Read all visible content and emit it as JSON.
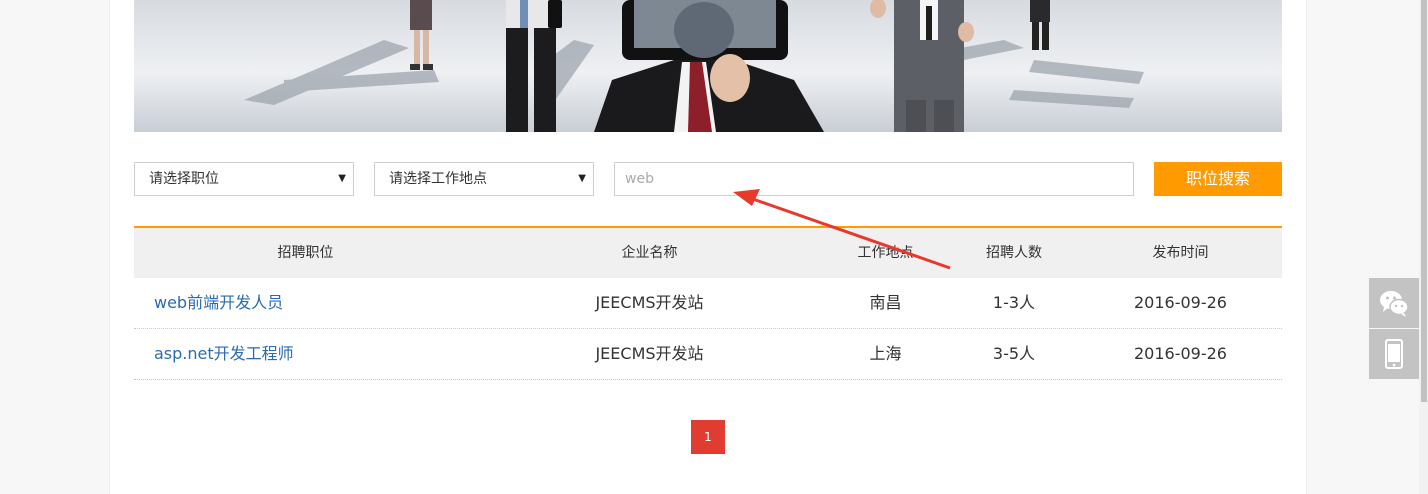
{
  "filters": {
    "position_select": "请选择职位",
    "location_select": "请选择工作地点",
    "keyword_value": "web",
    "search_button": "职位搜索"
  },
  "table": {
    "headers": [
      "招聘职位",
      "企业名称",
      "工作地点",
      "招聘人数",
      "发布时间"
    ],
    "rows": [
      {
        "job": "web前端开发人员",
        "company": "JEECMS开发站",
        "location": "南昌",
        "count": "1-3人",
        "date": "2016-09-26"
      },
      {
        "job": "asp.net开发工程师",
        "company": "JEECMS开发站",
        "location": "上海",
        "count": "3-5人",
        "date": "2016-09-26"
      }
    ]
  },
  "pagination": {
    "current": "1"
  },
  "side_tools": {
    "icons": [
      "wechat-icon",
      "mobile-icon"
    ]
  },
  "colors": {
    "accent": "#ff9a00",
    "link": "#2a6bb5",
    "pager": "#e03c31",
    "annotation": "#e8392d"
  }
}
